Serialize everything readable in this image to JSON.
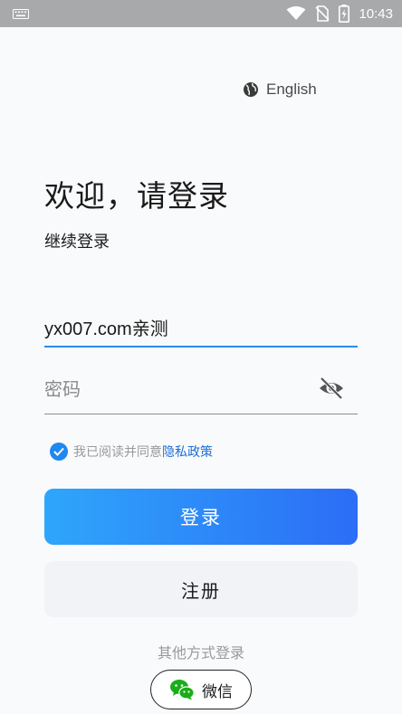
{
  "status_bar": {
    "time": "10:43",
    "icons": [
      "keyboard-icon",
      "wifi-icon",
      "no-sim-icon",
      "battery-charging-icon"
    ]
  },
  "language": {
    "icon": "globe-icon",
    "label": "English"
  },
  "header": {
    "title": "欢迎，请登录",
    "subtitle": "继续登录"
  },
  "form": {
    "account_value": "yx007.com亲测",
    "password_placeholder": "密码",
    "password_toggle_icon": "eye-off-icon"
  },
  "agreement": {
    "checked": true,
    "text": "我已阅读并同意",
    "link": "隐私政策"
  },
  "buttons": {
    "login": "登录",
    "register": "注册"
  },
  "other_login": {
    "label": "其他方式登录",
    "wechat_label": "微信"
  },
  "colors": {
    "accent": "#2b8cf0",
    "gradient_start": "#2ea6fb",
    "gradient_end": "#2c6df6",
    "link": "#1f6fd4",
    "wechat_green": "#1aad19"
  }
}
